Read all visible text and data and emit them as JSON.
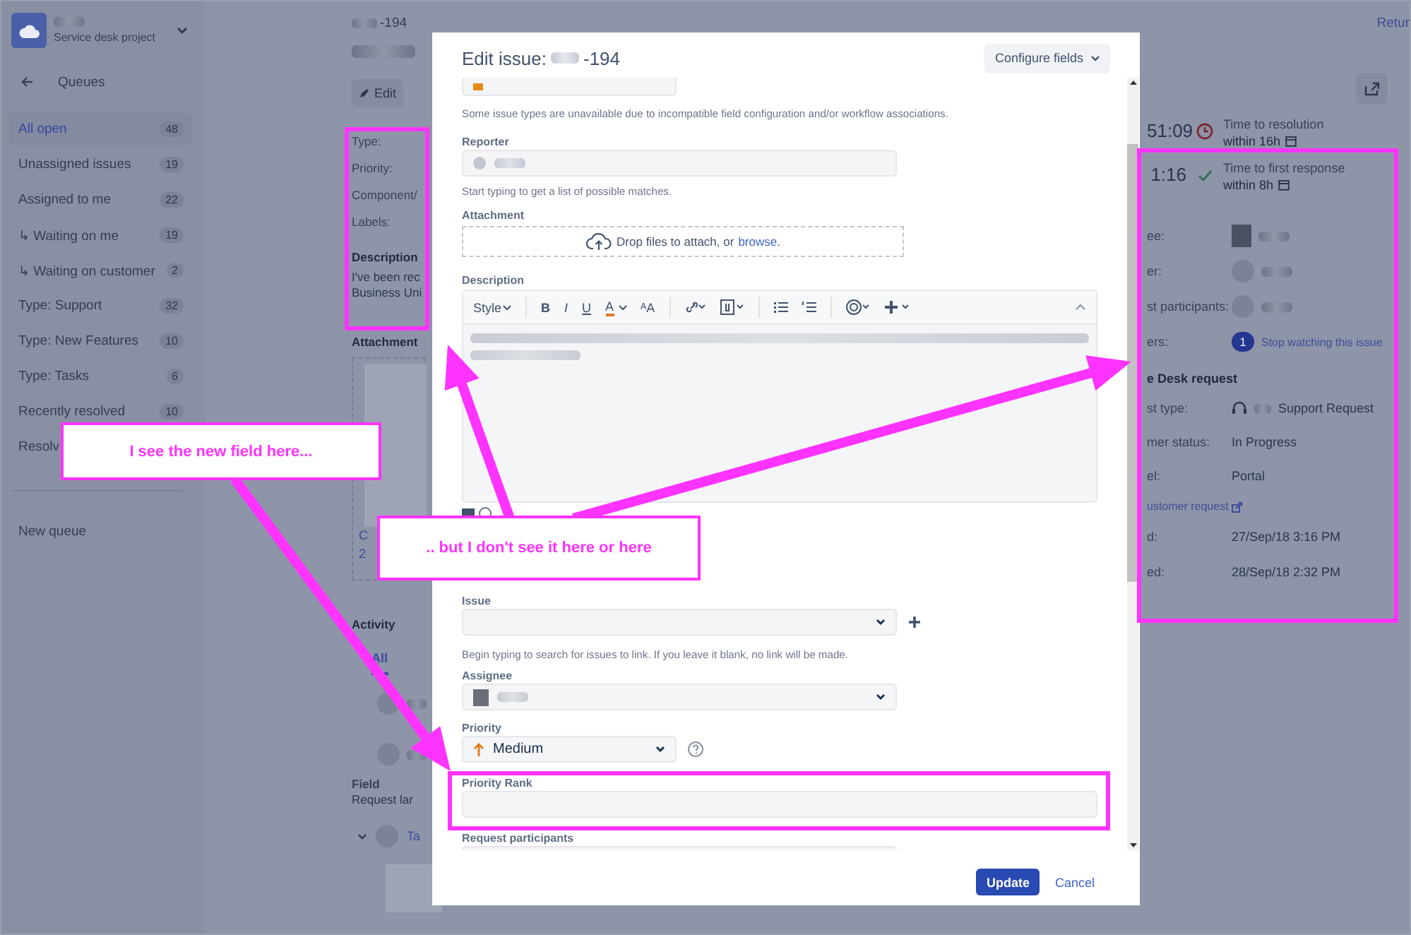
{
  "sidebar": {
    "project_subtitle": "Service desk project",
    "back_label": "Queues",
    "queues": [
      {
        "label": "All open",
        "count": "48",
        "selected": true
      },
      {
        "label": "Unassigned issues",
        "count": "19",
        "selected": false
      },
      {
        "label": "Assigned to me",
        "count": "22",
        "selected": false
      },
      {
        "label": "↳ Waiting on me",
        "count": "19",
        "selected": false
      },
      {
        "label": "↳ Waiting on customer",
        "count": "2",
        "selected": false
      },
      {
        "label": "Type: Support",
        "count": "32",
        "selected": false
      },
      {
        "label": "Type: New Features",
        "count": "10",
        "selected": false
      },
      {
        "label": "Type: Tasks",
        "count": "6",
        "selected": false
      },
      {
        "label": "Recently resolved",
        "count": "10",
        "selected": false
      },
      {
        "label": "Resolv",
        "selected": false
      }
    ],
    "new_queue": "New queue"
  },
  "issue_view": {
    "key": "-194",
    "edit_button": "Edit",
    "fields": [
      "Type:",
      "Priority:",
      "Component/",
      "Labels:"
    ],
    "description_heading": "Description",
    "description_lines": [
      "I've been rec",
      "Business Uni"
    ],
    "attachments_heading": "Attachment",
    "attachment_card_lines": [
      "C",
      "2"
    ],
    "activity_heading": "Activity",
    "activity_tabs": [
      {
        "label": "All",
        "selected": true
      }
    ],
    "field_label": "Field",
    "field_value": "Request lar",
    "history_item": "Ta"
  },
  "right_panel": {
    "return_link": "Retur",
    "sla": [
      {
        "time": "51:09",
        "kind": "breached",
        "name": "Time to resolution",
        "target": "within 16h"
      },
      {
        "time": "1:16",
        "kind": "met",
        "name": "Time to first response",
        "target": "within 8h"
      }
    ],
    "people": [
      "ee:",
      "er:",
      "st participants:"
    ],
    "watchers": {
      "label": "ers:",
      "count": "1",
      "link": "Stop watching this issue"
    },
    "request_heading": "e Desk request",
    "request_rows": [
      {
        "label": "st type:",
        "value": "Support Request",
        "kind": "request_type"
      },
      {
        "label": "mer status:",
        "value": "In Progress",
        "kind": "text"
      },
      {
        "label": "el:",
        "value": "Portal",
        "kind": "text"
      }
    ],
    "customer_request_link": "ustomer request",
    "dates": [
      {
        "label": "d:",
        "value": "27/Sep/18 3:16 PM"
      },
      {
        "label": "ed:",
        "value": "28/Sep/18 2:32 PM"
      }
    ]
  },
  "modal": {
    "title": "Edit issue:",
    "issue_key": "-194",
    "configure_button": "Configure fields",
    "issue_type_hint": "Some issue types are unavailable due to incompatible field configuration and/or workflow associations.",
    "reporter": {
      "label": "Reporter",
      "hint": "Start typing to get a list of possible matches."
    },
    "attachment": {
      "label": "Attachment",
      "drop_text": "Drop files to attach, or",
      "browse_link": "browse."
    },
    "description": {
      "label": "Description",
      "style_menu": "Style",
      "bold": "B",
      "italic": "I",
      "underline": "U",
      "text_color": "A",
      "text_size": "ᴬA"
    },
    "linked_issue": {
      "label": "Issue",
      "hint": "Begin typing to search for issues to link. If you leave it blank, no link will be made."
    },
    "assignee": {
      "label": "Assignee"
    },
    "priority": {
      "label": "Priority",
      "value": "Medium"
    },
    "priority_rank": {
      "label": "Priority Rank"
    },
    "participants": {
      "label": "Request participants"
    },
    "update_button": "Update",
    "cancel_link": "Cancel"
  },
  "annotations": {
    "callouts": [
      "I see the new field here...",
      ".. but I don't see it here or here"
    ]
  }
}
